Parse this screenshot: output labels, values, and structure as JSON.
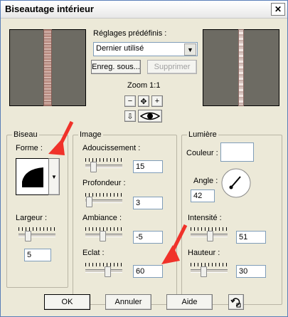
{
  "window": {
    "title": "Biseautage intérieur",
    "close_glyph": "✕"
  },
  "presets": {
    "label": "Réglages prédéfinis :",
    "selected": "Dernier utilisé",
    "save_label": "Enreg. sous...",
    "delete_label": "Supprimer"
  },
  "zoom": {
    "label": "Zoom 1:1",
    "zoom_out": "−",
    "pan": "✥",
    "zoom_in": "+",
    "reset": "⇩"
  },
  "bevel": {
    "title": "Biseau",
    "shape_label": "Forme :",
    "width_label": "Largeur :",
    "width_value": "5",
    "width_level": 0.2
  },
  "image": {
    "title": "Image",
    "smoothing_label": "Adoucissement :",
    "smoothing_value": "15",
    "smoothing_level": 0.15,
    "depth_label": "Profondeur :",
    "depth_value": "3",
    "depth_level": 0.03,
    "ambiance_label": "Ambiance :",
    "ambiance_value": "-5",
    "ambiance_level": 0.45,
    "brightness_label": "Eclat :",
    "brightness_value": "60",
    "brightness_level": 0.6
  },
  "light": {
    "title": "Lumière",
    "color_label": "Couleur :",
    "color_value": "#ffffff",
    "angle_label": "Angle :",
    "angle_value": "42",
    "intensity_label": "Intensité :",
    "intensity_value": "51",
    "intensity_level": 0.51,
    "height_label": "Hauteur :",
    "height_value": "30",
    "height_level": 0.3
  },
  "footer": {
    "ok_label": "OK",
    "cancel_label": "Annuler",
    "help_label": "Aide"
  },
  "colors": {
    "annotation_arrow": "#f0322a",
    "dialog_bg": "#ece9d8"
  }
}
